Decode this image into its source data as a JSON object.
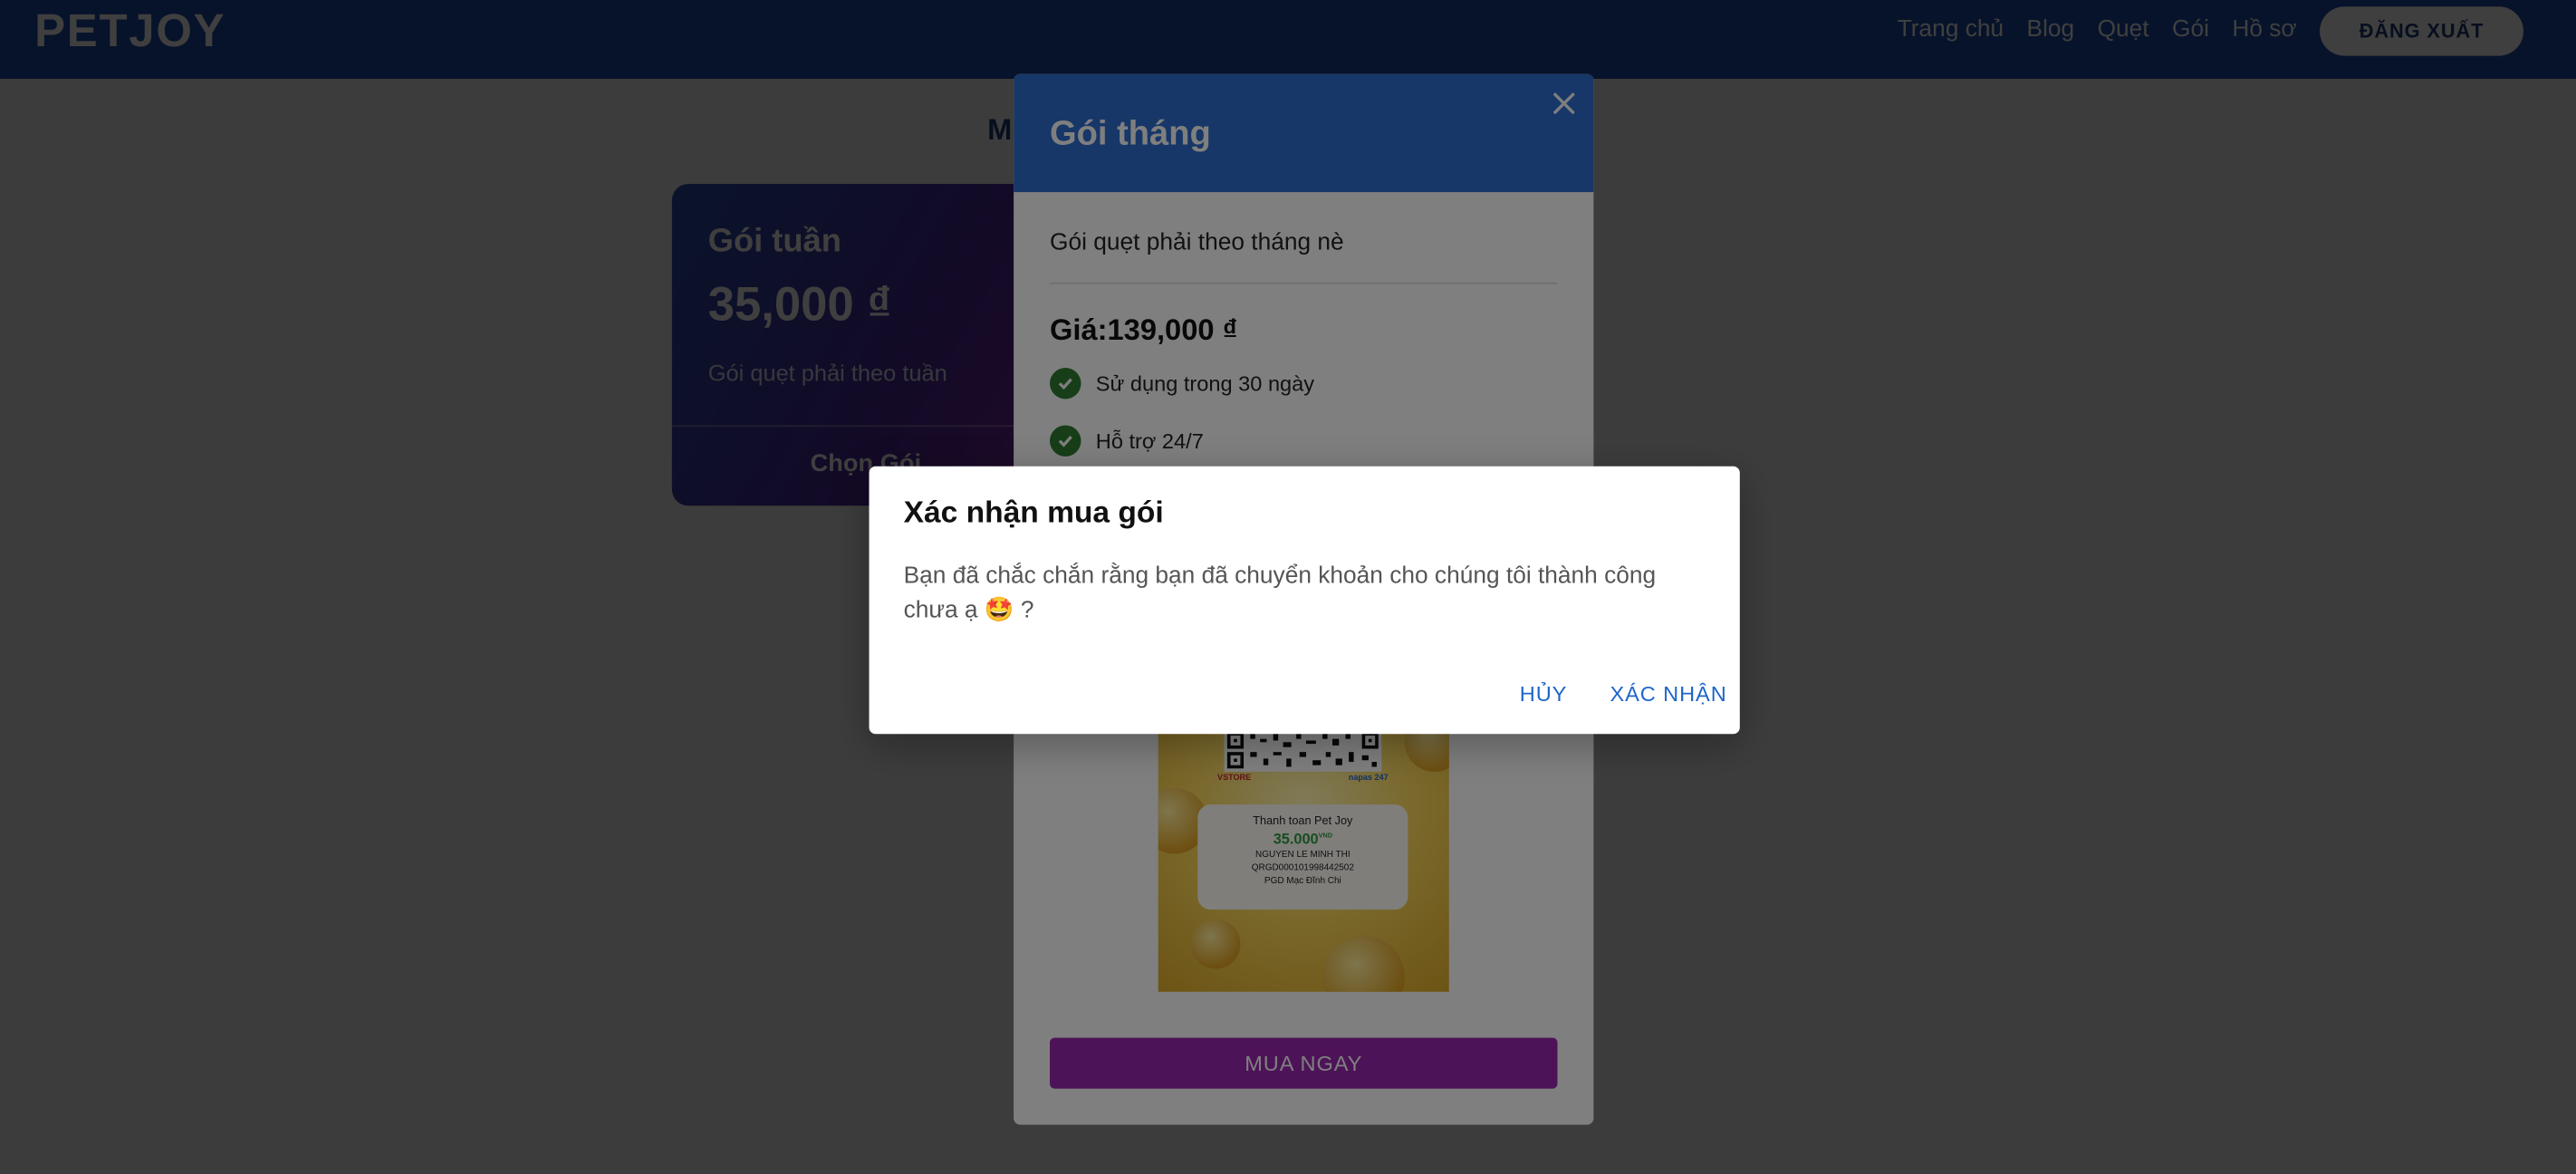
{
  "navbar": {
    "logo": "PETJOY",
    "links": [
      "Trang chủ",
      "Blog",
      "Quẹt",
      "Gói",
      "Hồ sơ"
    ],
    "logout_label": "ĐĂNG XUẤT",
    "color": "#1e4fa8"
  },
  "page": {
    "heading": "M"
  },
  "week_package": {
    "title": "Gói tuần",
    "price": "35,000 ₫",
    "description": "Gói quẹt phải theo tuần",
    "choose_label": "Chọn Gói"
  },
  "month_modal": {
    "title": "Gói tháng",
    "description": "Gói quẹt phải theo tháng nè",
    "price_label": "Giá:139,000 ₫",
    "features": [
      "Sử dụng trong 30 ngày",
      "Hỗ trợ 24/7"
    ],
    "qr": {
      "pay_title": "Thanh toan Pet Joy",
      "amount": "35.000",
      "amount_unit": "VND",
      "account_name": "NGUYEN LE MINH THI",
      "account_code": "QRGD000101998442502",
      "branch": "PGD Mạc Đĩnh Chi",
      "brand_left": "VSTORE",
      "brand_right": "napas 247"
    },
    "buy_label": "MUA NGAY",
    "buy_color": "#9b27b0",
    "header_color": "#2f6fd1"
  },
  "confirm_dialog": {
    "title": "Xác nhận mua gói",
    "message": "Bạn đã chắc chắn rằng bạn đã chuyển khoản cho chúng tôi thành công chưa ạ 🤩 ?",
    "cancel_label": "HỦY",
    "confirm_label": "XÁC NHẬN",
    "action_color": "#1e66c8"
  }
}
